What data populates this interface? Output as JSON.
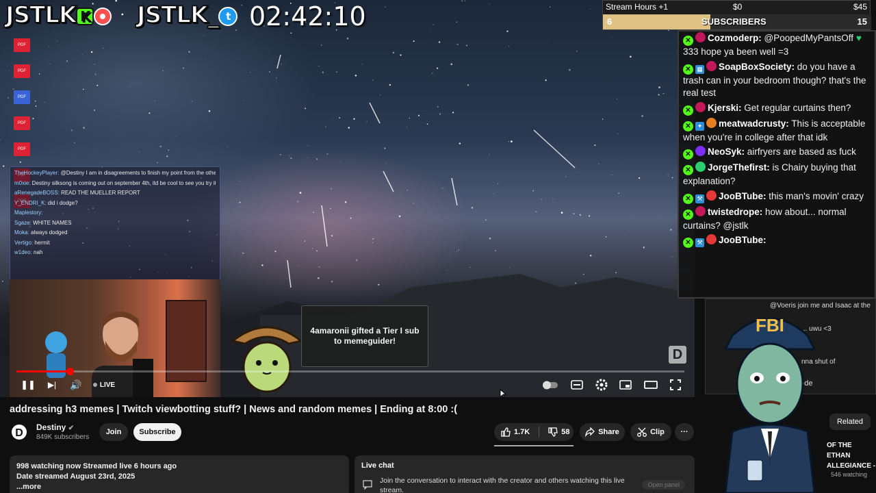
{
  "overlay": {
    "brand_left": "JSTLK",
    "brand_k": "K",
    "brand_right": "JSTLK_",
    "twitter_glyph": "t",
    "timer": "02:42:10",
    "goal": {
      "label": "Stream Hours +1",
      "min": "$0",
      "max": "$45",
      "subs_count": "6",
      "subs_label": "SUBSCRIBERS",
      "subs_goal": "15",
      "progress": 0.4
    },
    "d_logo": "D"
  },
  "desktop_icons": [
    "PDF",
    "PDF",
    "PDF",
    "PDF",
    "PDF",
    "PDF",
    "PDF"
  ],
  "mini_chat": [
    {
      "user": "TheHockeyPlayer:",
      "text": "@Destiny I am in disagreements to finish my point from the other day, I never got to finish it."
    },
    {
      "user": "m0xie:",
      "text": "Destiny silksong is coming out on september 4th, itd be cool to see you try it"
    },
    {
      "user": "aRenegadeBOSS:",
      "text": "READ THE MUELLER REPORT"
    },
    {
      "user": "Y_ENDRI_K:",
      "text": "did i dodge?"
    },
    {
      "user": "Maplestory:",
      "text": ""
    },
    {
      "user": "Sgaze:",
      "text": "WHITE NAMES"
    },
    {
      "user": "Moka:",
      "text": "always dodged"
    },
    {
      "user": "Vertigo:",
      "text": "hermit"
    },
    {
      "user": "w1deo:",
      "text": "nah"
    }
  ],
  "toast": "4amaronii gifted a Tier I sub to memeguider!",
  "chat": [
    {
      "user": "Cozmoderp:",
      "text": "@PoopedMyPantsOff",
      "heart": "♥",
      "text2": "333 hope ya been well =3",
      "avatar": "#c2185b",
      "badge": ""
    },
    {
      "user": "SoapBoxSociety:",
      "text": "do you have a trash can in your bedroom though? that's the real test",
      "avatar": "#c2185b",
      "badge": "▦"
    },
    {
      "user": "Kjerski:",
      "text": "Get regular curtains then?",
      "avatar": "#c2185b",
      "badge": ""
    },
    {
      "user": "meatwadcrusty:",
      "text": "This is acceptable when you're in college after that idk",
      "avatar": "#e67e22",
      "badge": "✦"
    },
    {
      "user": "NeoSyk:",
      "text": "airfryers are based as fuck",
      "avatar": "#7b2ff7",
      "badge": ""
    },
    {
      "user": "JorgeThefirst:",
      "text": "is Chairy buying that explanation?",
      "avatar": "#2ecc71",
      "badge": ""
    },
    {
      "user": "JooBTube:",
      "text": "this man's movin' crazy",
      "avatar": "#e53935",
      "badge": "⚒"
    },
    {
      "user": "twistedrope:",
      "text": "how about... normal curtains? @jstlk",
      "avatar": "#c2185b",
      "badge": ""
    },
    {
      "user": "JooBTube:",
      "text": "",
      "avatar": "#e53935",
      "badge": "⚒"
    }
  ],
  "player": {
    "play_icon": "❚❚",
    "next_icon": "▶|",
    "volume_icon": "🔊",
    "live_label": "LIVE",
    "progress": 0.08
  },
  "side": {
    "chat_line1": "@Voeris join me and Isaac at the",
    "chat_line2": "... uwu <3",
    "chat_line3": "nna shut of",
    "mode": "mode",
    "related": "Related",
    "video_title": "OF THE ETHAN ALLEGIANCE -",
    "watching": "546 watching"
  },
  "video_title": "addressing h3 memes | Twitch viewbotting stuff? | News and random memes | Ending at 8:00 :(",
  "channel": {
    "avatar_letter": "D",
    "name": "Destiny",
    "verified": "✔",
    "subs": "849K subscribers",
    "join": "Join",
    "subscribe": "Subscribe"
  },
  "actions": {
    "likes": "1.7K",
    "dislikes": "58",
    "share": "Share",
    "clip": "Clip",
    "more": "···"
  },
  "description": {
    "line1": "998 watching now  Streamed live 6 hours ago",
    "line2": "Date streamed August 23rd, 2025",
    "more": "...more"
  },
  "live_chat": {
    "title": "Live chat",
    "text": "Join the conversation to interact with the creator and others watching this live stream.",
    "open": "Open panel"
  }
}
